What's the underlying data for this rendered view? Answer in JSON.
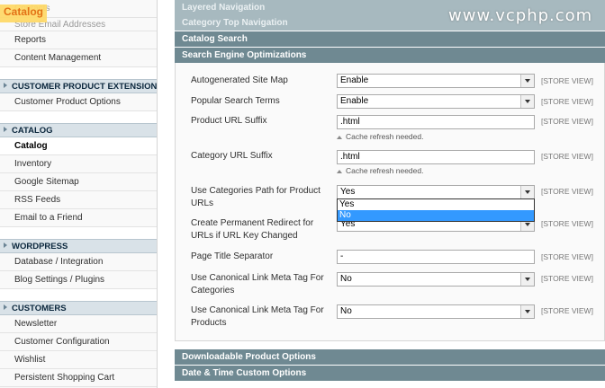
{
  "sidebar": {
    "faded_top": [
      "Contacts",
      "Store Email Addresses"
    ],
    "overlay_title": "Catalog",
    "group_general_items": [
      "Reports",
      "Content Management"
    ],
    "section_customer_ext": "CUSTOMER PRODUCT EXTENSION",
    "customer_ext_items": [
      "Customer Product Options"
    ],
    "section_catalog": "CATALOG",
    "catalog_active": "Catalog",
    "catalog_items": [
      "Inventory",
      "Google Sitemap",
      "RSS Feeds",
      "Email to a Friend"
    ],
    "section_wordpress": "WORDPRESS",
    "wordpress_items": [
      "Database / Integration",
      "Blog Settings / Plugins"
    ],
    "section_customers": "CUSTOMERS",
    "customers_items": [
      "Newsletter",
      "Customer Configuration",
      "Wishlist",
      "Persistent Shopping Cart"
    ]
  },
  "main": {
    "top_faded_sections": [
      "Layered Navigation",
      "Category Top Navigation"
    ],
    "section_catalog_search": "Catalog Search",
    "section_seo": "Search Engine Optimizations",
    "section_downloadable": "Downloadable Product Options",
    "section_datetime": "Date & Time Custom Options",
    "scope_label": "[STORE VIEW]",
    "cache_note": "Cache refresh needed.",
    "fields": {
      "sitemap": {
        "label": "Autogenerated Site Map",
        "value": "Enable"
      },
      "popular": {
        "label": "Popular Search Terms",
        "value": "Enable"
      },
      "product_suffix": {
        "label": "Product URL Suffix",
        "value": ".html"
      },
      "category_suffix": {
        "label": "Category URL Suffix",
        "value": ".html"
      },
      "cat_path": {
        "label": "Use Categories Path for Product URLs",
        "value": "Yes"
      },
      "redirect": {
        "label": "Create Permanent Redirect for URLs if URL Key Changed",
        "value": "Yes"
      },
      "title_sep": {
        "label": "Page Title Separator",
        "value": "-"
      },
      "canon_cat": {
        "label": "Use Canonical Link Meta Tag For Categories",
        "value": "No"
      },
      "canon_prod": {
        "label": "Use Canonical Link Meta Tag For Products",
        "value": "No"
      }
    },
    "dropdown_options": [
      "Yes",
      "No"
    ]
  },
  "watermark": "www.vcphp.com",
  "colors": {
    "section_bar": "#6f8992",
    "sidebar_head": "#d9e2e8",
    "overlay_text": "#e26703",
    "highlight": "#3399ff"
  }
}
